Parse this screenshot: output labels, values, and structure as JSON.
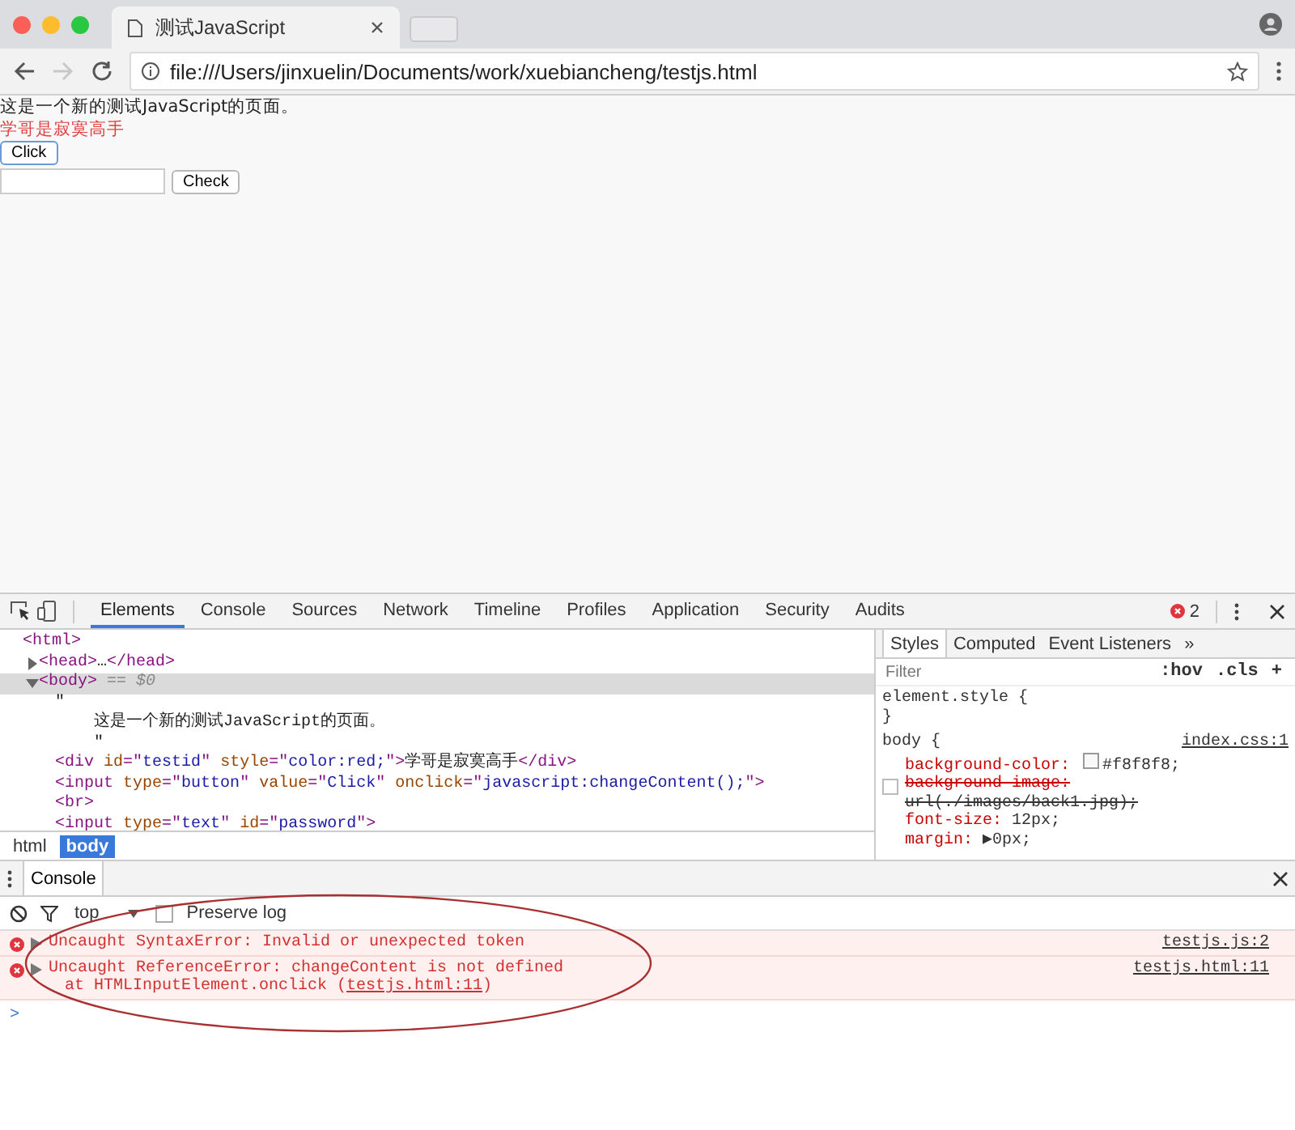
{
  "browser": {
    "tab": {
      "title": "测试JavaScript"
    },
    "url": "file:///Users/jinxuelin/Documents/work/xuebiancheng/testjs.html",
    "forward_disabled": true
  },
  "page": {
    "paragraph": "这是一个新的测试JavaScript的页面。",
    "red_text": "学哥是寂寞高手",
    "click_button": "Click",
    "check_button": "Check"
  },
  "devtools": {
    "tabs": [
      {
        "label": "Elements",
        "selected": true
      },
      {
        "label": "Console",
        "selected": false
      },
      {
        "label": "Sources",
        "selected": false
      },
      {
        "label": "Network",
        "selected": false
      },
      {
        "label": "Timeline",
        "selected": false
      },
      {
        "label": "Profiles",
        "selected": false
      },
      {
        "label": "Application",
        "selected": false
      },
      {
        "label": "Security",
        "selected": false
      },
      {
        "label": "Audits",
        "selected": false
      }
    ],
    "error_count": "2",
    "dom_tree": [
      {
        "tokens": [
          {
            "kind": "tag",
            "text": "<html>"
          }
        ],
        "children": [
          {
            "tokens": [
              {
                "kind": "tag",
                "text": "<head>"
              },
              {
                "kind": "plain",
                "text": "…"
              },
              {
                "kind": "tag",
                "text": "</head>"
              }
            ],
            "expanded": false,
            "selected": false
          },
          {
            "tokens": [
              {
                "kind": "tag",
                "text": "<body>"
              },
              {
                "kind": "dim",
                "text": " == "
              },
              {
                "kind": "dimitalic",
                "text": "$0"
              }
            ],
            "expanded": true,
            "selected": true,
            "children": [
              {
                "tokens": [
                  {
                    "kind": "plain",
                    "text": "\""
                  }
                ]
              },
              {
                "tokens": [
                  {
                    "kind": "plain",
                    "text": "    这是一个新的测试JavaScript的页面。"
                  }
                ]
              },
              {
                "tokens": [
                  {
                    "kind": "plain",
                    "text": "    \""
                  }
                ]
              },
              {
                "tokens": [
                  {
                    "kind": "tag",
                    "text": "<div"
                  },
                  {
                    "kind": "attr",
                    "text": " id"
                  },
                  {
                    "kind": "tag",
                    "text": "=\""
                  },
                  {
                    "kind": "value",
                    "text": "testid"
                  },
                  {
                    "kind": "tag",
                    "text": "\""
                  },
                  {
                    "kind": "attr",
                    "text": " style"
                  },
                  {
                    "kind": "tag",
                    "text": "=\""
                  },
                  {
                    "kind": "value",
                    "text": "color:red;"
                  },
                  {
                    "kind": "tag",
                    "text": "\">"
                  },
                  {
                    "kind": "plain",
                    "text": "学哥是寂寞高手"
                  },
                  {
                    "kind": "tag",
                    "text": "</div>"
                  }
                ]
              },
              {
                "tokens": [
                  {
                    "kind": "tag",
                    "text": "<input"
                  },
                  {
                    "kind": "attr",
                    "text": " type"
                  },
                  {
                    "kind": "tag",
                    "text": "=\""
                  },
                  {
                    "kind": "value",
                    "text": "button"
                  },
                  {
                    "kind": "tag",
                    "text": "\""
                  },
                  {
                    "kind": "attr",
                    "text": " value"
                  },
                  {
                    "kind": "tag",
                    "text": "=\""
                  },
                  {
                    "kind": "value",
                    "text": "Click"
                  },
                  {
                    "kind": "tag",
                    "text": "\""
                  },
                  {
                    "kind": "attr",
                    "text": " onclick"
                  },
                  {
                    "kind": "tag",
                    "text": "=\""
                  },
                  {
                    "kind": "value",
                    "text": "javascript:changeContent();"
                  },
                  {
                    "kind": "tag",
                    "text": "\">"
                  }
                ]
              },
              {
                "tokens": [
                  {
                    "kind": "tag",
                    "text": "<br>"
                  }
                ]
              },
              {
                "tokens": [
                  {
                    "kind": "tag",
                    "text": "<input"
                  },
                  {
                    "kind": "attr",
                    "text": " type"
                  },
                  {
                    "kind": "tag",
                    "text": "=\""
                  },
                  {
                    "kind": "value",
                    "text": "text"
                  },
                  {
                    "kind": "tag",
                    "text": "\""
                  },
                  {
                    "kind": "attr",
                    "text": " id"
                  },
                  {
                    "kind": "tag",
                    "text": "=\""
                  },
                  {
                    "kind": "value",
                    "text": "password"
                  },
                  {
                    "kind": "tag",
                    "text": "\">"
                  }
                ]
              }
            ]
          }
        ]
      }
    ],
    "breadcrumbs": [
      {
        "label": "html",
        "selected": false
      },
      {
        "label": "body",
        "selected": true
      }
    ],
    "styles_tabs": [
      {
        "label": "Styles",
        "selected": true
      },
      {
        "label": "Computed",
        "selected": false
      },
      {
        "label": "Event Listeners",
        "selected": false
      }
    ],
    "styles_more": "»",
    "filter": {
      "placeholder": "Filter"
    },
    "filter_buttons": [
      ":hov",
      ".cls",
      "+"
    ],
    "rules": [
      {
        "selector": "element.style {",
        "close": "}"
      },
      {
        "selector": "body {",
        "source": "index.css:1",
        "properties": [
          {
            "name": "background-color:",
            "value": "#f8f8f8;",
            "color_swatch": true,
            "overridden": false
          },
          {
            "name": "background-image:",
            "value": "url(./images/back1.jpg);",
            "color_swatch": false,
            "overridden": true
          },
          {
            "name": "font-size:",
            "value": "12px;",
            "color_swatch": false,
            "overridden": false
          },
          {
            "name": "margin:",
            "value": "▶0px;",
            "color_swatch": false,
            "overridden": false
          }
        ]
      }
    ]
  },
  "console": {
    "drawer_tab": {
      "label": "Console",
      "selected": true
    },
    "context": "top",
    "preserve_log": {
      "label": "Preserve log",
      "checked": false
    },
    "messages": [
      {
        "kind": "error",
        "expanded": false,
        "text": "Uncaught SyntaxError: Invalid or unexpected token",
        "source": "testjs.js:2"
      },
      {
        "kind": "error",
        "expanded": false,
        "text": "Uncaught ReferenceError: changeContent is not defined",
        "stack": "at HTMLInputElement.onclick (",
        "stack_link": "testjs.html:11",
        "stack_end": ")",
        "source": "testjs.html:11"
      }
    ],
    "prompt": ">"
  }
}
